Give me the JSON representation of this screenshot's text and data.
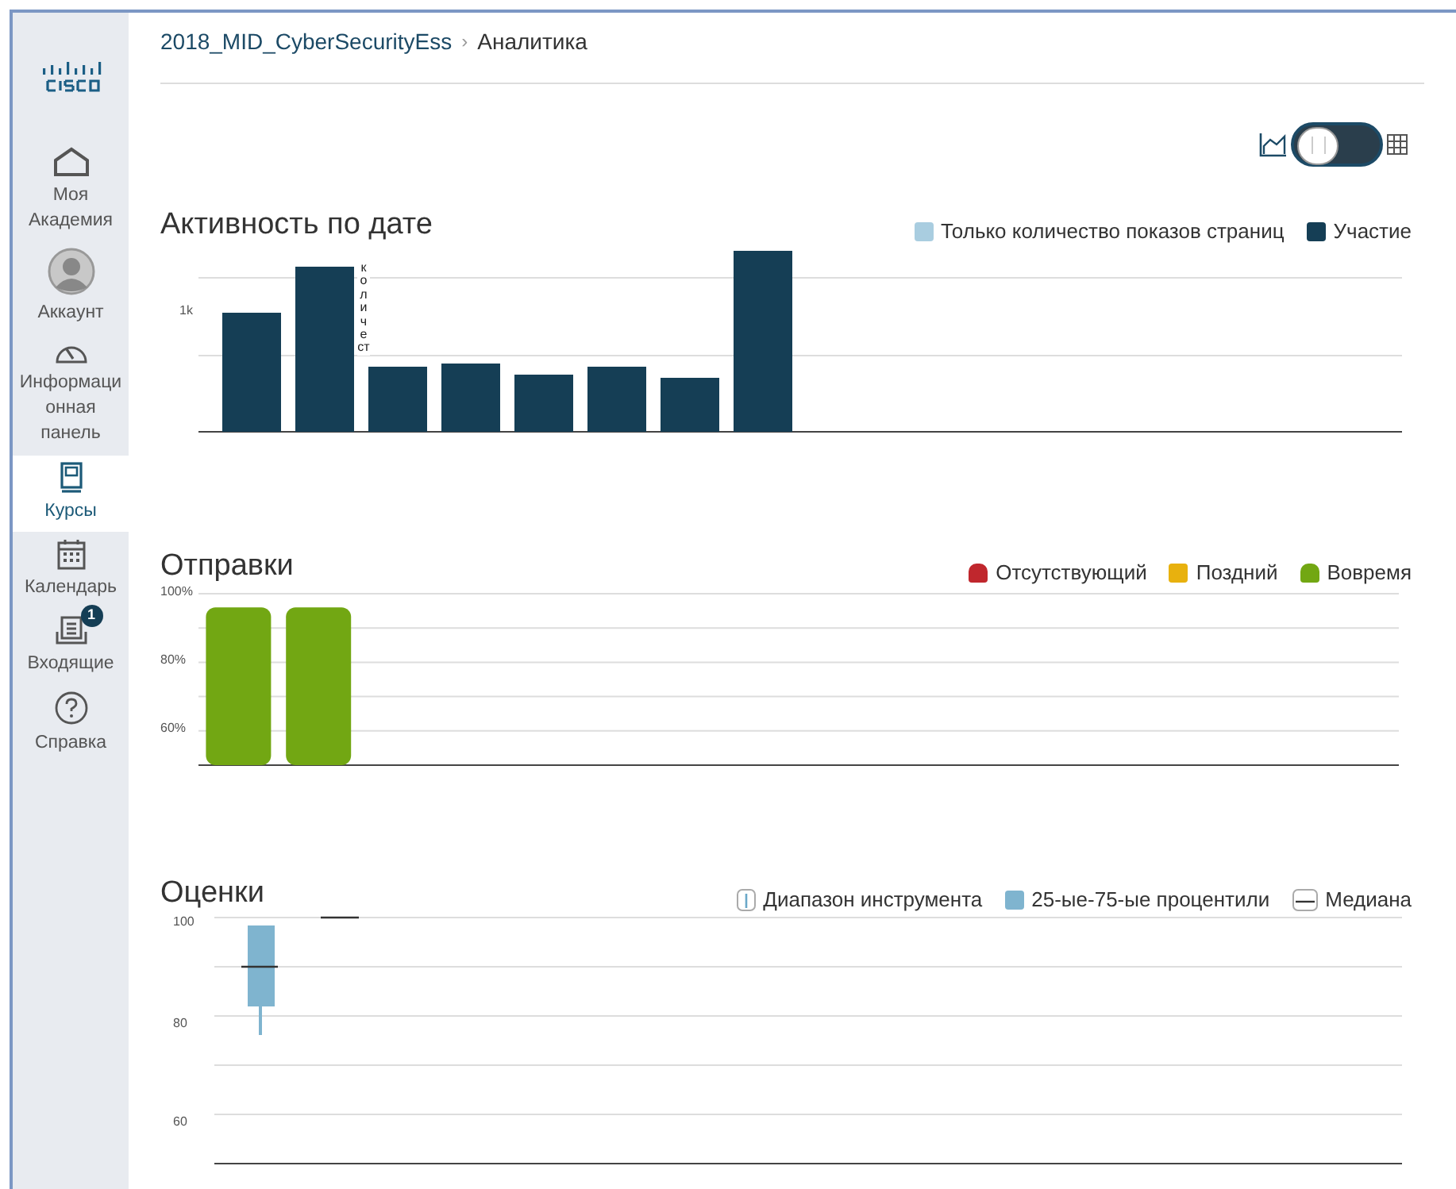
{
  "sidebar": {
    "items": [
      {
        "kind": "home",
        "label": "Моя Академия",
        "selected": false
      },
      {
        "kind": "account",
        "label": "Аккаунт",
        "selected": false
      },
      {
        "kind": "dashboard",
        "label": "Информационная панель",
        "selected": false
      },
      {
        "kind": "courses",
        "label": "Курсы",
        "selected": true
      },
      {
        "kind": "calendar",
        "label": "Календарь",
        "selected": false
      },
      {
        "kind": "inbox",
        "label": "Входящие",
        "selected": false,
        "badge": "1"
      },
      {
        "kind": "help",
        "label": "Справка",
        "selected": false
      }
    ]
  },
  "breadcrumb": {
    "course": "2018_MID_CyberSecurityEss",
    "separator": "›",
    "page": "Аналитика"
  },
  "view_toggle": {
    "on": false
  },
  "activity": {
    "title": "Активность по дате",
    "legend": [
      {
        "label": "Только количество показов страниц",
        "color": "#a9cde0"
      },
      {
        "label": "Участие",
        "color": "#153e55"
      }
    ],
    "y_label": "1k",
    "bar_label": "количест"
  },
  "submissions": {
    "title": "Отправки",
    "chart_data": {
      "type": "bar",
      "categories": [
        null,
        null,
        null,
        null,
        null,
        null,
        null,
        null,
        null,
        null,
        null,
        null,
        null,
        null,
        null
      ],
      "ylim": [
        50,
        100
      ],
      "yticks": [
        {
          "value": 100,
          "label": "100%"
        },
        {
          "value": 80,
          "label": "80%"
        },
        {
          "value": 60,
          "label": "60%"
        }
      ],
      "series": [
        {
          "name": "Отсутствующий",
          "color": "#c0272d",
          "values": [
            null,
            null,
            null,
            null,
            null,
            null,
            null,
            null,
            null,
            null,
            null,
            null,
            null,
            null,
            null
          ]
        },
        {
          "name": "Поздний",
          "color": "#e8b10e",
          "values": [
            null,
            null,
            null,
            null,
            null,
            null,
            null,
            null,
            null,
            null,
            null,
            null,
            null,
            null,
            null
          ]
        },
        {
          "name": "Вовремя",
          "color": "#72a713",
          "values": [
            96,
            96,
            null,
            null,
            null,
            null,
            null,
            null,
            null,
            null,
            null,
            null,
            null,
            null,
            null
          ]
        }
      ]
    }
  },
  "grades": {
    "title": "Оценки",
    "legend": [
      {
        "kind": "range",
        "label": "Диапазон инструмента"
      },
      {
        "kind": "box",
        "label": "25-ые-75-ые процентили"
      },
      {
        "kind": "median",
        "label": "Медиана"
      }
    ],
    "y_labels": [
      "100",
      "80",
      "60"
    ]
  }
}
